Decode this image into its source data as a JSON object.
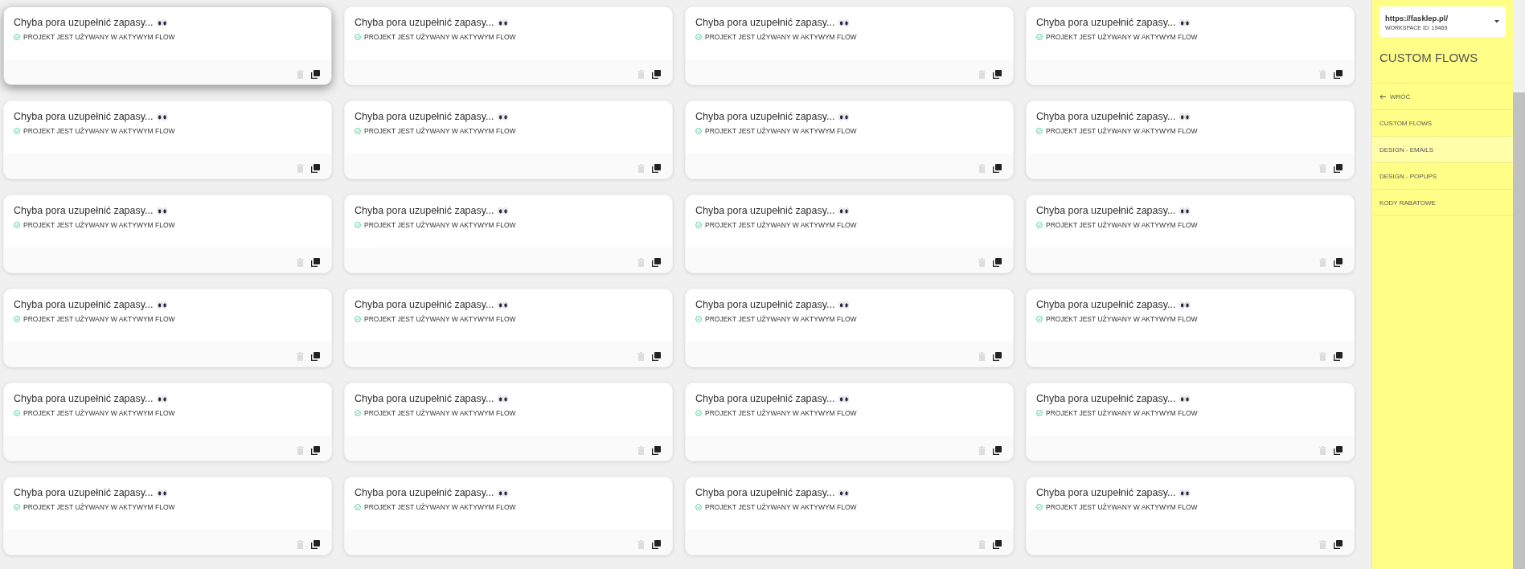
{
  "cards": [
    {
      "title": "Chyba pora uzupełnić zapasy...",
      "status": "PROJEKT JEST UŻYWANY W AKTYWYM FLOW",
      "hovered": true
    },
    {
      "title": "Chyba pora uzupełnić zapasy...",
      "status": "PROJEKT JEST UŻYWANY W AKTYWYM FLOW",
      "hovered": false
    },
    {
      "title": "Chyba pora uzupełnić zapasy...",
      "status": "PROJEKT JEST UŻYWANY W AKTYWYM FLOW",
      "hovered": false
    },
    {
      "title": "Chyba pora uzupełnić zapasy...",
      "status": "PROJEKT JEST UŻYWANY W AKTYWYM FLOW",
      "hovered": false
    },
    {
      "title": "Chyba pora uzupełnić zapasy...",
      "status": "PROJEKT JEST UŻYWANY W AKTYWYM FLOW",
      "hovered": false
    },
    {
      "title": "Chyba pora uzupełnić zapasy...",
      "status": "PROJEKT JEST UŻYWANY W AKTYWYM FLOW",
      "hovered": false
    },
    {
      "title": "Chyba pora uzupełnić zapasy...",
      "status": "PROJEKT JEST UŻYWANY W AKTYWYM FLOW",
      "hovered": false
    },
    {
      "title": "Chyba pora uzupełnić zapasy...",
      "status": "PROJEKT JEST UŻYWANY W AKTYWYM FLOW",
      "hovered": false
    },
    {
      "title": "Chyba pora uzupełnić zapasy...",
      "status": "PROJEKT JEST UŻYWANY W AKTYWYM FLOW",
      "hovered": false
    },
    {
      "title": "Chyba pora uzupełnić zapasy...",
      "status": "PROJEKT JEST UŻYWANY W AKTYWYM FLOW",
      "hovered": false
    },
    {
      "title": "Chyba pora uzupełnić zapasy...",
      "status": "PROJEKT JEST UŻYWANY W AKTYWYM FLOW",
      "hovered": false
    },
    {
      "title": "Chyba pora uzupełnić zapasy...",
      "status": "PROJEKT JEST UŻYWANY W AKTYWYM FLOW",
      "hovered": false
    },
    {
      "title": "Chyba pora uzupełnić zapasy...",
      "status": "PROJEKT JEST UŻYWANY W AKTYWYM FLOW",
      "hovered": false
    },
    {
      "title": "Chyba pora uzupełnić zapasy...",
      "status": "PROJEKT JEST UŻYWANY W AKTYWYM FLOW",
      "hovered": false
    },
    {
      "title": "Chyba pora uzupełnić zapasy...",
      "status": "PROJEKT JEST UŻYWANY W AKTYWYM FLOW",
      "hovered": false
    },
    {
      "title": "Chyba pora uzupełnić zapasy...",
      "status": "PROJEKT JEST UŻYWANY W AKTYWYM FLOW",
      "hovered": false
    },
    {
      "title": "Chyba pora uzupełnić zapasy...",
      "status": "PROJEKT JEST UŻYWANY W AKTYWYM FLOW",
      "hovered": false
    },
    {
      "title": "Chyba pora uzupełnić zapasy...",
      "status": "PROJEKT JEST UŻYWANY W AKTYWYM FLOW",
      "hovered": false
    },
    {
      "title": "Chyba pora uzupełnić zapasy...",
      "status": "PROJEKT JEST UŻYWANY W AKTYWYM FLOW",
      "hovered": false
    },
    {
      "title": "Chyba pora uzupełnić zapasy...",
      "status": "PROJEKT JEST UŻYWANY W AKTYWYM FLOW",
      "hovered": false
    },
    {
      "title": "Chyba pora uzupełnić zapasy...",
      "status": "PROJEKT JEST UŻYWANY W AKTYWYM FLOW",
      "hovered": false
    },
    {
      "title": "Chyba pora uzupełnić zapasy...",
      "status": "PROJEKT JEST UŻYWANY W AKTYWYM FLOW",
      "hovered": false
    },
    {
      "title": "Chyba pora uzupełnić zapasy...",
      "status": "PROJEKT JEST UŻYWANY W AKTYWYM FLOW",
      "hovered": false
    },
    {
      "title": "Chyba pora uzupełnić zapasy...",
      "status": "PROJEKT JEST UŻYWANY W AKTYWYM FLOW",
      "hovered": false
    }
  ],
  "sidebar": {
    "account": {
      "url": "https://fasklep.pl/",
      "workspace": "WORKSPACE ID: 19469"
    },
    "title": "CUSTOM FLOWS",
    "items": [
      {
        "kind": "back",
        "label": "WRÓĆ",
        "selected": false
      },
      {
        "kind": "link",
        "label": "CUSTOM FLOWS",
        "selected": false
      },
      {
        "kind": "link",
        "label": "DESIGN - EMAILS",
        "selected": true
      },
      {
        "kind": "link",
        "label": "DESIGN - POPUPS",
        "selected": false
      },
      {
        "kind": "link",
        "label": "KODY RABATOWE",
        "selected": false
      }
    ]
  }
}
